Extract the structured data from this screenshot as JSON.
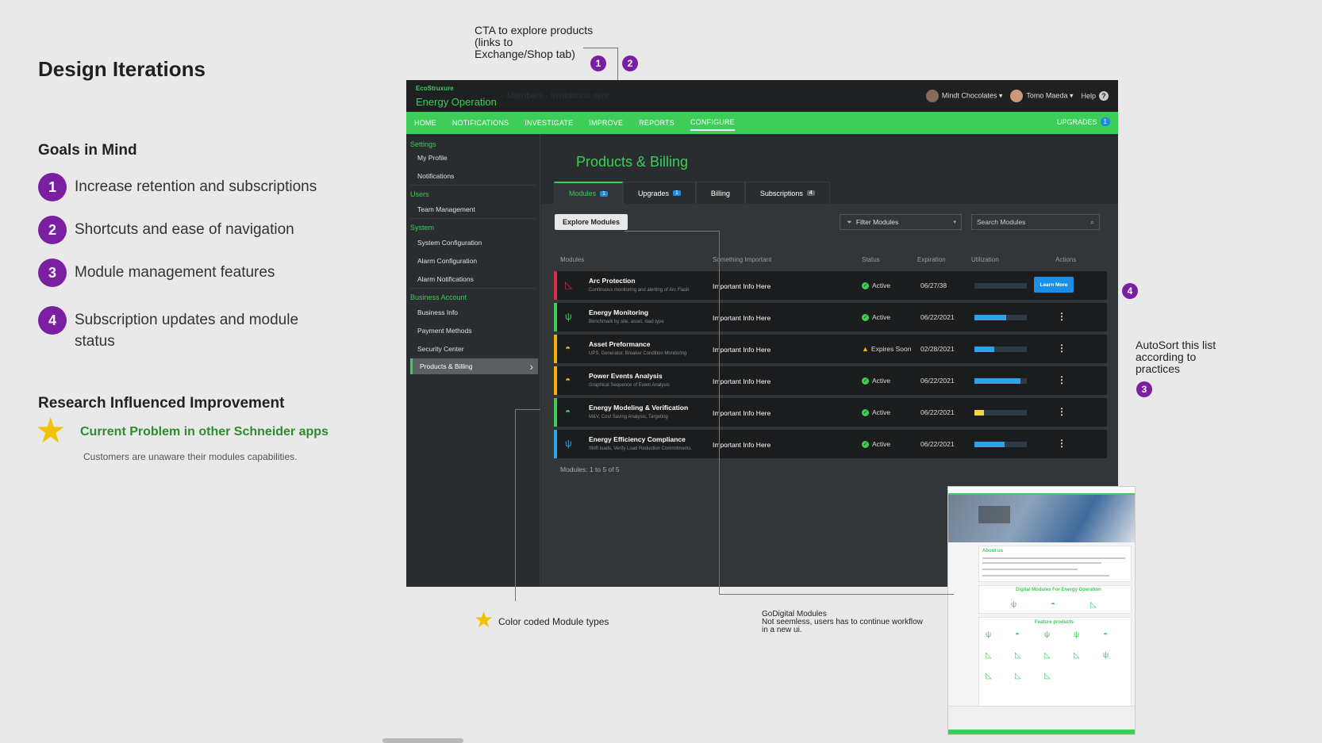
{
  "left": {
    "title": "Design Iterations",
    "goals_heading": "Goals in Mind",
    "goals": [
      {
        "num": "1",
        "text": "Increase retention and subscriptions"
      },
      {
        "num": "2",
        "text": "Shortcuts and ease of navigation"
      },
      {
        "num": "3",
        "text": "Module management features"
      },
      {
        "num": "4",
        "text": "Subscription updates and module status"
      }
    ],
    "research_heading": "Research Influenced Improvement",
    "problem_title": "Current Problem in other Schneider apps",
    "problem_text": "Customers are unaware their modules capabilities."
  },
  "annotations": {
    "cta": "CTA to explore products (links to Exchange/Shop tab)",
    "autosort": "AutoSort this list according to practices",
    "color_coded": "Color coded Module types",
    "godigital_title": "GoDigital Modules",
    "godigital_text": "Not seemless, users has to continue workflow in a new ui.",
    "pins": [
      "1",
      "2",
      "3",
      "4"
    ]
  },
  "app": {
    "brand_top": "EcoStruxure",
    "brand": "Energy Operation",
    "ghost_text": "- Members - Invitations sent",
    "company": "Mindt Chocolates",
    "user": "Tomo Maeda",
    "help": "Help",
    "nav": [
      "HOME",
      "NOTIFICATIONS",
      "INVESTIGATE",
      "IMPROVE",
      "REPORTS",
      "CONFIGURE"
    ],
    "nav_active": "CONFIGURE",
    "upgrades_label": "UPGRADES",
    "upgrades_count": "1",
    "sidebar": {
      "settings": "Settings",
      "my_profile": "My Profile",
      "notifications": "Notifications",
      "users": "Users",
      "team_management": "Team Management",
      "system": "System",
      "system_configuration": "System Configuration",
      "alarm_configuration": "Alarm Configuration",
      "alarm_notifications": "Alarm Notifications",
      "business_account": "Business Account",
      "business_info": "Business Info",
      "payment_methods": "Payment Methods",
      "security_center": "Security Center",
      "products_billing": "Products & Billing"
    },
    "page_title": "Products & Billing",
    "tabs": [
      {
        "label": "Modules",
        "count": "1"
      },
      {
        "label": "Upgrades",
        "count": "1"
      },
      {
        "label": "Billing",
        "count": ""
      },
      {
        "label": "Subscriptions",
        "count": "4"
      }
    ],
    "explore_button": "Explore Modules",
    "filter_label": "Filter Modules",
    "search_placeholder": "Search Modules",
    "columns": [
      "Modules",
      "Something Important",
      "Status",
      "Expiration",
      "Utilization",
      "Actions"
    ],
    "rows": [
      {
        "name": "Arc Protection",
        "sub": "Continuous monitoring and alerting of Arc Flash",
        "info": "Important Info Here",
        "status": "Active",
        "expiration": "06/27/38",
        "utilization": 0.0,
        "color": "#e0284f",
        "icon": "arc-icon",
        "action": "Learn More"
      },
      {
        "name": "Energy Monitoring",
        "sub": "Benchmark by site, asset, load type",
        "info": "Important Info Here",
        "status": "Active",
        "expiration": "06/22/2021",
        "utilization": 0.6,
        "color": "#3dcd58",
        "icon": "leaf-icon",
        "action": ""
      },
      {
        "name": "Asset Preformance",
        "sub": "UPS, Generator, Breaker Condition Monitoring",
        "info": "Important Info Here",
        "status": "Expires Soon",
        "expiration": "02/28/2021",
        "utilization": 0.38,
        "color": "#f5b400",
        "icon": "eye-icon",
        "action": ""
      },
      {
        "name": "Power Events Analysis",
        "sub": "Graphical Sequence of Event Analysis",
        "info": "Important Info Here",
        "status": "Active",
        "expiration": "06/22/2021",
        "utilization": 0.88,
        "color": "#f5b400",
        "icon": "eye-icon",
        "action": ""
      },
      {
        "name": "Energy Modeling & Verification",
        "sub": "M&V, Cost Saving Analysis, Targeting",
        "info": "Important Info Here",
        "status": "Active",
        "expiration": "06/22/2021",
        "utilization": 0.18,
        "color": "#3dcd58",
        "icon": "eye-icon",
        "action": ""
      },
      {
        "name": "Energy Efficiency Compliance",
        "sub": "Shift loads, Verify Load Reduction Commitments",
        "info": "Important Info Here",
        "status": "Active",
        "expiration": "06/22/2021",
        "utilization": 0.58,
        "color": "#2ba5e8",
        "icon": "leaf-icon",
        "action": ""
      }
    ],
    "count_label": "Modules: 1 to 5 of 5"
  },
  "thumbnail": {
    "heading": "Digital Modules For Energy Operation",
    "about": "About us",
    "featured": "Feature products"
  }
}
